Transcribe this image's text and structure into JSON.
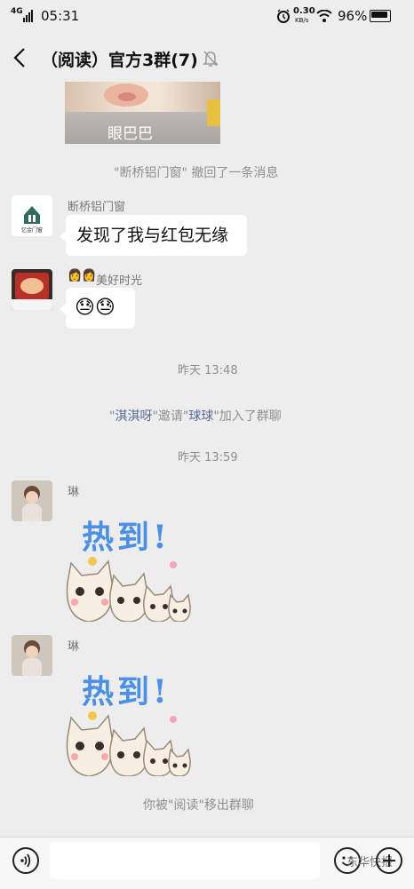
{
  "status_bar": {
    "network": "4G",
    "time": "05:31",
    "speed_value": "0.30",
    "speed_unit": "KB/s",
    "battery": "96%"
  },
  "header": {
    "title": "（阅读）官方3群(7)"
  },
  "messages": {
    "prev_image_caption": "眼巴巴",
    "recall_notice": "\"断桥铝门窗\" 撤回了一条消息",
    "msg1": {
      "sender": "断桥铝门窗",
      "avatar_label": "忆金门窗",
      "text": "发现了我与红包无缘"
    },
    "msg2": {
      "sender_emoji": "👩👩",
      "sender": "美好时光",
      "text": "😓😓"
    },
    "time1": "昨天 13:48",
    "invite": {
      "q1": "\"",
      "inviter": "淇淇呀",
      "mid": "\"邀请\"",
      "invitee": "球球",
      "tail": "\"加入了群聊"
    },
    "time2": "昨天 13:59",
    "msg3": {
      "sender": "琳",
      "sticker_text": "热到!"
    },
    "msg4": {
      "sender": "琳",
      "sticker_text": "热到!"
    },
    "removed_notice": "你被\"阅读\"移出群聊"
  },
  "bottom": {
    "watermark": "东华快报"
  },
  "colors": {
    "background": "#ededed",
    "link": "#576b95",
    "bubble": "#ffffff"
  }
}
